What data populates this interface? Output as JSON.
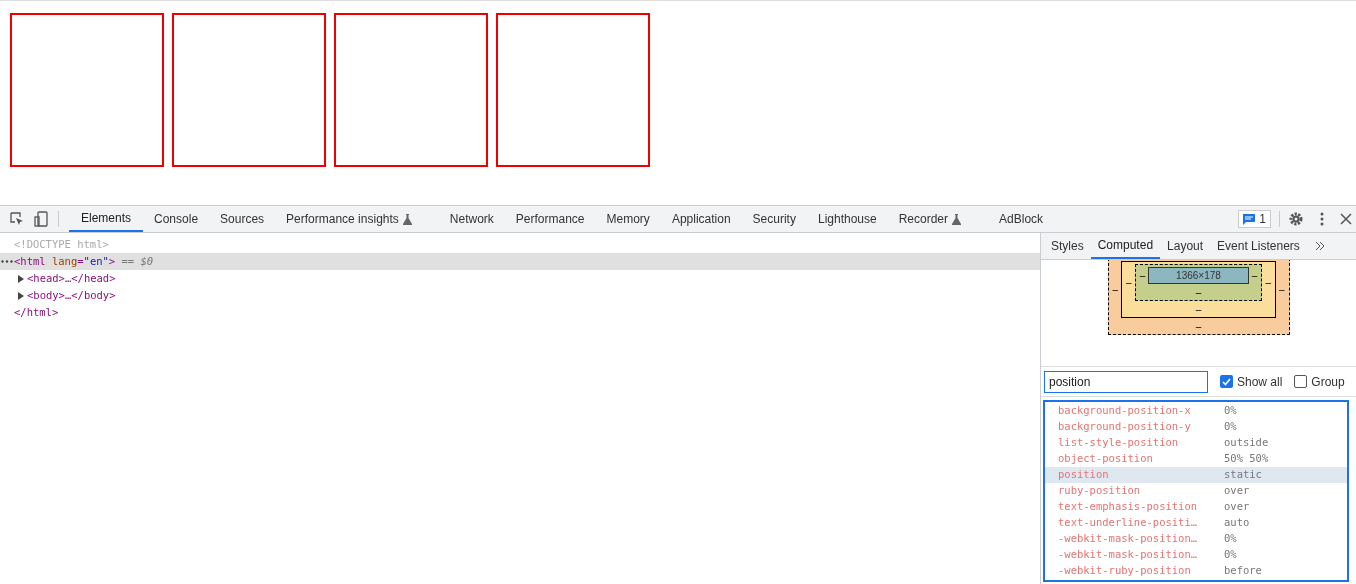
{
  "devtools": {
    "tabs": [
      {
        "label": "Elements",
        "selected": true,
        "experimental": false
      },
      {
        "label": "Console",
        "selected": false,
        "experimental": false
      },
      {
        "label": "Sources",
        "selected": false,
        "experimental": false
      },
      {
        "label": "Performance insights",
        "selected": false,
        "experimental": true
      },
      {
        "label": "Network",
        "selected": false,
        "experimental": false
      },
      {
        "label": "Performance",
        "selected": false,
        "experimental": false
      },
      {
        "label": "Memory",
        "selected": false,
        "experimental": false
      },
      {
        "label": "Application",
        "selected": false,
        "experimental": false
      },
      {
        "label": "Security",
        "selected": false,
        "experimental": false
      },
      {
        "label": "Lighthouse",
        "selected": false,
        "experimental": false
      },
      {
        "label": "Recorder",
        "selected": false,
        "experimental": true
      },
      {
        "label": "AdBlock",
        "selected": false,
        "experimental": false
      }
    ],
    "issues_count": "1",
    "dom": [
      {
        "collapsed": false,
        "selected": false,
        "segments": [
          {
            "kind": "doctype",
            "text": "<!DOCTYPE html>"
          }
        ]
      },
      {
        "collapsed": false,
        "selected": true,
        "segments": [
          {
            "kind": "tag",
            "text": "<html "
          },
          {
            "kind": "attr",
            "text": "lang"
          },
          {
            "kind": "tag",
            "text": "="
          },
          {
            "kind": "value",
            "text": "\"en\""
          },
          {
            "kind": "tag",
            "text": ">"
          },
          {
            "kind": "comment",
            "text": " == $0"
          }
        ]
      },
      {
        "collapsed": true,
        "selected": false,
        "segments": [
          {
            "kind": "tag",
            "text": "<head>…</head>"
          }
        ]
      },
      {
        "collapsed": true,
        "selected": false,
        "segments": [
          {
            "kind": "tag",
            "text": "<body>…</body>"
          }
        ]
      },
      {
        "collapsed": false,
        "selected": false,
        "segments": [
          {
            "kind": "tag",
            "text": "</html>"
          }
        ]
      }
    ],
    "sidebar_tabs": [
      {
        "label": "Styles",
        "selected": false
      },
      {
        "label": "Computed",
        "selected": true
      },
      {
        "label": "Layout",
        "selected": false
      },
      {
        "label": "Event Listeners",
        "selected": false
      }
    ],
    "box_model": {
      "content": "1366×178",
      "margin": "–",
      "border": "–",
      "padding": "–"
    },
    "filter": {
      "value": "position",
      "show_all": {
        "label": "Show all",
        "checked": true
      },
      "group": {
        "label": "Group",
        "checked": false
      }
    },
    "properties": [
      {
        "name": "background-position-x",
        "value": "0%",
        "selected": false
      },
      {
        "name": "background-position-y",
        "value": "0%",
        "selected": false
      },
      {
        "name": "list-style-position",
        "value": "outside",
        "selected": false
      },
      {
        "name": "object-position",
        "value": "50% 50%",
        "selected": false
      },
      {
        "name": "position",
        "value": "static",
        "selected": true
      },
      {
        "name": "ruby-position",
        "value": "over",
        "selected": false
      },
      {
        "name": "text-emphasis-position",
        "value": "over",
        "selected": false
      },
      {
        "name": "text-underline-positi…",
        "value": "auto",
        "selected": false
      },
      {
        "name": "-webkit-mask-position…",
        "value": "0%",
        "selected": false
      },
      {
        "name": "-webkit-mask-position…",
        "value": "0%",
        "selected": false
      },
      {
        "name": "-webkit-ruby-position",
        "value": "before",
        "selected": false
      }
    ]
  }
}
